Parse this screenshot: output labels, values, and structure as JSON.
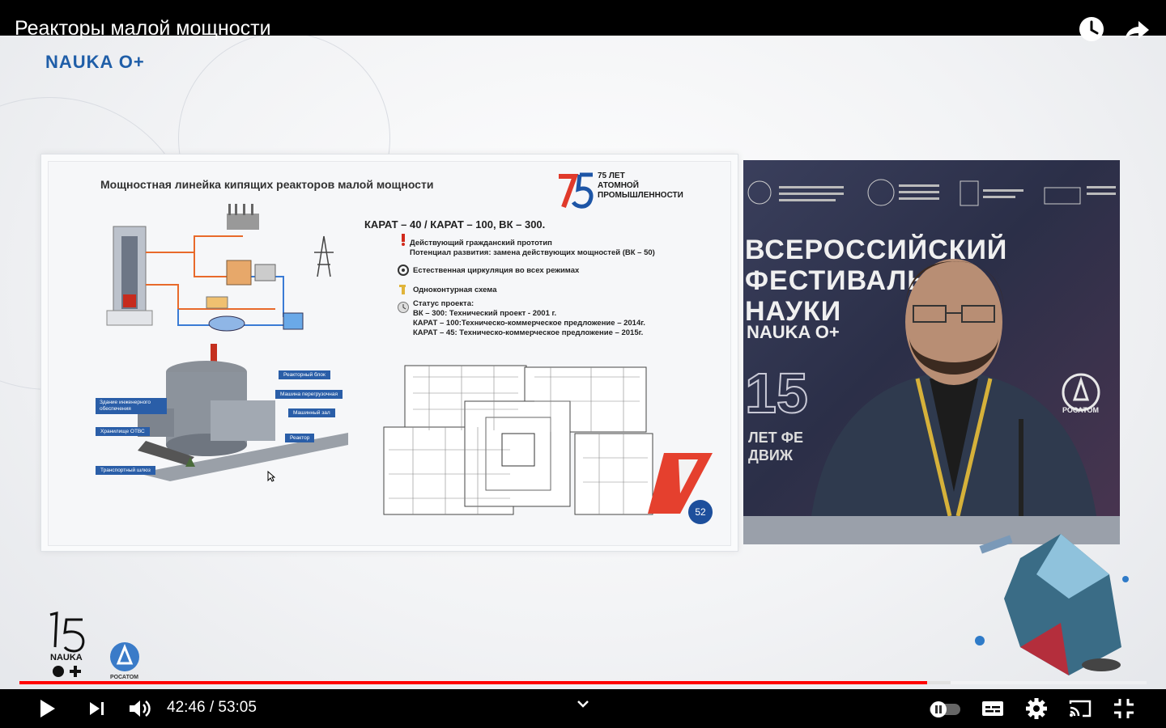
{
  "player": {
    "title": "Реакторы малой мощности",
    "current_time": "42:46",
    "separator": " / ",
    "duration": "53:05",
    "progress_played": 0.805,
    "progress_buffered": 0.826
  },
  "channel": {
    "logo_text": "NAUKA O+"
  },
  "slide": {
    "title": "Мощностная линейка кипящих реакторов малой мощности",
    "anniversary": "75 ЛЕТ\nАТОМНОЙ\nПРОМЫШЛЕННОСТИ",
    "karat_title": "КАРАТ – 40 / КАРАТ – 100, ВК – 300.",
    "features": [
      {
        "line1": "Действующий гражданский прототип",
        "line2": "Потенциал развития: замена действующих мощностей (ВК – 50)"
      },
      {
        "line1": "Естественная циркуляция во всех режимах"
      },
      {
        "line1": "Одноконтурная схема"
      }
    ],
    "status": {
      "heading": "Статус проекта:",
      "lines": [
        "ВК – 300:     Технический проект -  2001 г.",
        "КАРАТ – 100:Техническо-коммерческое предложение – 2014г.",
        "КАРАТ – 45: Техническо-коммерческое предложение – 2015г."
      ]
    },
    "callouts": {
      "reactor_block": "Реакторный блок",
      "refuel_machine": "Машина перегрузочная",
      "machine_hall": "Машинный зал",
      "reactor": "Реактор",
      "engineering_building": "Здание инженерного обеспечения",
      "storage": "Хранилище ОТВС",
      "transport": "Транспортный шлюз"
    },
    "page_number": "52"
  },
  "speaker_bg": {
    "festival_text": "ВСЕРОССИЙСКИЙ\nФЕСТИВАЛЬ\nНАУКИ",
    "festival_brand": "NAUKA O+",
    "festival_15": "15",
    "festival_years": "ЛЕТ ФЕ\nДВИЖ",
    "rosatom": "РОСАТОМ"
  },
  "bottom_logos": {
    "nauka": "NAUKA",
    "rosatom": "РОСАТОМ"
  },
  "colors": {
    "progress": "#ff0000",
    "slide_accent": "#2a5ea8",
    "brand": "#1f5ea8"
  },
  "icons": [
    "watch-later-icon",
    "share-icon",
    "play-icon",
    "next-icon",
    "volume-icon",
    "autoplay-toggle-icon",
    "subtitles-icon",
    "settings-icon",
    "cast-icon",
    "exit-fullscreen-icon",
    "chevron-down-icon"
  ]
}
